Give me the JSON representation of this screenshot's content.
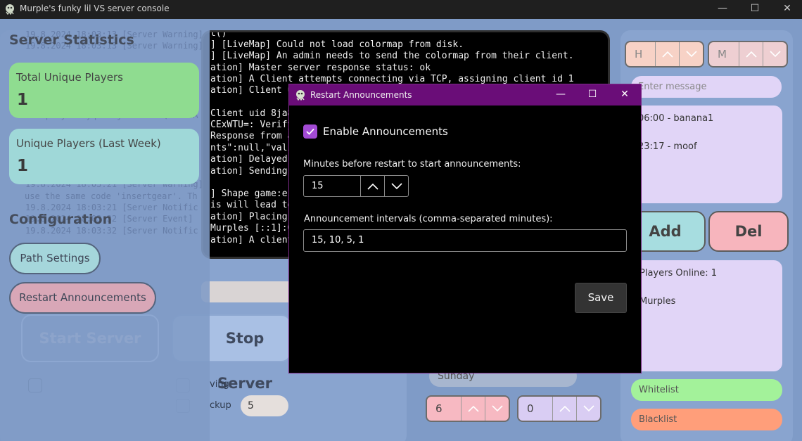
{
  "window": {
    "title": "Murple's funky lil VS server console",
    "minimize_glyph": "—",
    "maximize_glyph": "☐",
    "close_glyph": "✕"
  },
  "console": {
    "lines": [
      "t()",
      "] [LiveMap] Could not load colormap from disk.",
      "] [LiveMap] An admin needs to send the colormap from their client.",
      "ation] Master server response status: ok",
      "ation] A Client attempts connecting via TCP, assigning client id 1",
      "ation] Client u",
      "",
      "Client uid 8ja8",
      "CExWTU=: Verify",
      "Response from a",
      "nts\":null,\"vali",
      "ation] Delayed",
      "ation] Sending",
      "",
      "] Shape game:er",
      "is will lead to",
      "ation] Placing",
      "Murples [::1]:6",
      "ation] A client"
    ]
  },
  "left": {
    "server_statistics_title": "Server Statistics",
    "total_unique_label": "Total Unique Players",
    "total_unique_value": "1",
    "unique_week_label": "Unique Players (Last Week)",
    "unique_week_value": "1",
    "configuration_title": "Configuration",
    "path_settings_label": "Path Settings",
    "restart_announcements_label": "Restart Announcements",
    "start_server_label": "Start Server",
    "stop_server_label": "Stop Server",
    "saving_label": "ving",
    "backup_label": "ckup",
    "backup_value": "5",
    "background_console_lines": [
      "19.8.2024 18:03:13 [Server Warning]",
      "19.8.2024 18:03:13 [Server Warning]",
      "92bop0dy4x1OyqY8AXjOedcRsV1QeEN58A",
      "19.8.2024 18:03:21 [Server Warning]",
      "use the same code 'insertgear'. Th",
      "19.8.2024 18:03:21 [Server Notific",
      "19.8.2024 18:03:32 [Server Event]",
      "19.8.2024 18:03:32 [Server Notific"
    ]
  },
  "schedule": {
    "day_value": "Sunday",
    "hour_value": "6",
    "minute_value": "0"
  },
  "right": {
    "hour_placeholder": "H",
    "minute_placeholder": "M",
    "message_placeholder": "Enter message",
    "announcements": [
      "06:00 - banana1",
      "23:17 - moof"
    ],
    "add_label": "Add",
    "del_label": "Del",
    "players_online_label": "Players Online: 1",
    "players": [
      "Murples"
    ],
    "whitelist_label": "Whitelist",
    "blacklist_label": "Blacklist"
  },
  "dialog": {
    "title": "Restart Announcements",
    "enable_label": "Enable Announcements",
    "enabled": true,
    "minutes_label": "Minutes before restart to start announcements:",
    "minutes_value": "15",
    "intervals_label": "Announcement intervals (comma-separated minutes):",
    "intervals_value": "15, 10, 5, 1",
    "save_label": "Save"
  },
  "colors": {
    "background": "#7f9bc7",
    "panel": "#89a4cf",
    "dialog_titlebar": "#6a0d78",
    "checkbox_accent": "#a24ad4",
    "stat_green": "#8fdc90",
    "stat_cyan": "#9fd8d8",
    "add_button": "#a7dde0",
    "del_button": "#f7b5bd",
    "whitelist": "#a3f29a",
    "blacklist": "#ff9e7a",
    "lavender": "#e1d5f7"
  }
}
